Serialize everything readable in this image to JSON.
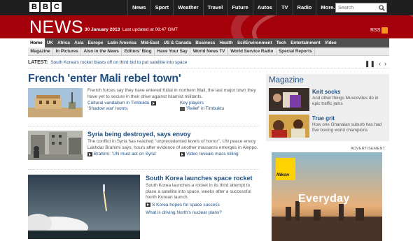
{
  "topbar": {
    "logo_letters": [
      "B",
      "B",
      "C"
    ],
    "nav": [
      "News",
      "Sport",
      "Weather",
      "Travel",
      "Future",
      "Autos",
      "TV",
      "Radio",
      "More..."
    ],
    "search_placeholder": "Search"
  },
  "banner": {
    "title": "NEWS",
    "date": "30 January 2013",
    "updated": "Last updated at 08:47 GMT",
    "rss_label": "RSS"
  },
  "section_nav": [
    "Home",
    "UK",
    "Africa",
    "Asia",
    "Europe",
    "Latin America",
    "Mid-East",
    "US & Canada",
    "Business",
    "Health",
    "Sci/Environment",
    "Tech",
    "Entertainment",
    "Video"
  ],
  "sub_nav": [
    "Magazine",
    "In Pictures",
    "Also in the News",
    "Editors' Blog",
    "Have Your Say",
    "World News TV",
    "World Service Radio",
    "Special Reports"
  ],
  "ticker": {
    "label": "LATEST:",
    "text": "South Korea's rocket blasts off on third bid to put satellite into space",
    "controls": [
      "❚❚",
      "‹",
      "›"
    ]
  },
  "lead": {
    "headline": "French 'enter Mali rebel town'",
    "text": "French forces say they have entered Kidal in northern Mali, the last major town they have yet to secure in their drive against Islamist militants.",
    "links": [
      {
        "label": "Cultural vandalism in Timbuktu",
        "icon": "video"
      },
      {
        "label": "Key players",
        "icon": "none"
      },
      {
        "label": "'Shadow war' looms",
        "icon": "none"
      },
      {
        "label": "'Relief' in Timbuktu",
        "icon": "audio"
      }
    ]
  },
  "story2": {
    "headline": "Syria being destroyed, says envoy",
    "text": "The conflict in Syria has reached \"unprecedented levels of horror\", UN peace envoy Lakhdar Brahimi says, hours after evidence of another massacre emerges in Aleppo.",
    "links": [
      {
        "label": "Brahimi: 'UN must act on Syria'",
        "icon": "video"
      },
      {
        "label": "Video reveals mass killing",
        "icon": "video"
      }
    ]
  },
  "story3": {
    "headline": "South Korea launches space rocket",
    "text": "South Korea launches a rocket in its third attempt to place a satellite into space, weeks after a successful North Korean launch.",
    "links": [
      {
        "label": "S Korea hopes for space success",
        "icon": "video"
      },
      {
        "label": "What is driving North's nuclear plans?",
        "icon": "none"
      }
    ]
  },
  "magazine": {
    "title": "Magazine",
    "items": [
      {
        "headline": "Knit socks",
        "text": "And other things Muscovites do in epic traffic jams"
      },
      {
        "headline": "True grit",
        "text": "How one Ghanaian suburb has had five boxing world champions"
      }
    ]
  },
  "advert": {
    "label": "ADVERTISEMENT",
    "brand": "Nikon",
    "word": "Everyday"
  }
}
